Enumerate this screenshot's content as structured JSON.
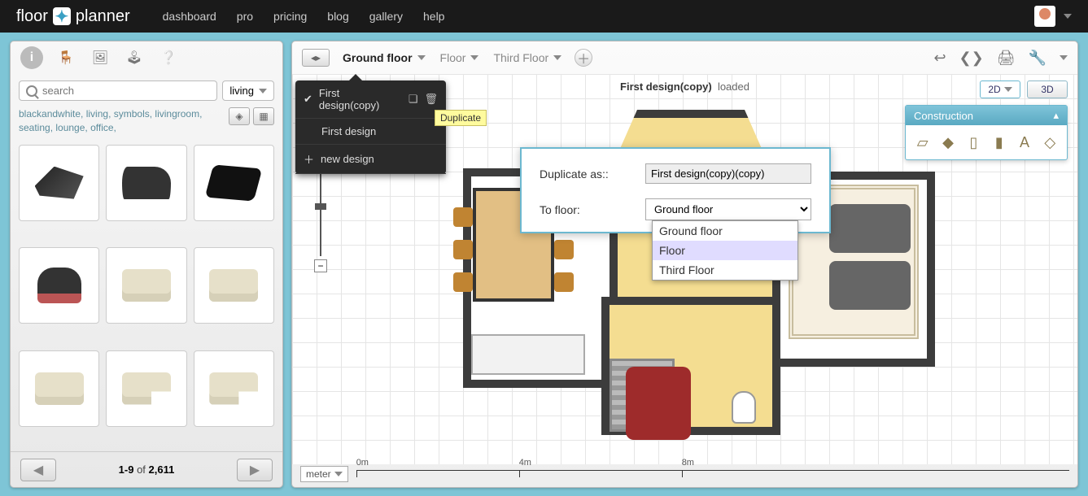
{
  "topnav": {
    "brand1": "floor",
    "brand2": "planner",
    "menu": [
      "dashboard",
      "pro",
      "pricing",
      "blog",
      "gallery",
      "help"
    ]
  },
  "sidebar": {
    "search_placeholder": "search",
    "category": "living",
    "tags": "blackandwhite, living, symbols, livingroom, seating, lounge, office,",
    "page_range": "1-9",
    "page_of": "of",
    "page_total": "2,611"
  },
  "floors": {
    "tabs": [
      {
        "label": "Ground floor",
        "active": true
      },
      {
        "label": "Floor",
        "active": false
      },
      {
        "label": "Third Floor",
        "active": false
      }
    ]
  },
  "design_menu": {
    "items": [
      {
        "label": "First design(copy)",
        "checked": true,
        "has_actions": true
      },
      {
        "label": "First design",
        "checked": false,
        "has_actions": false
      }
    ],
    "new_label": "new design",
    "tooltip": "Duplicate"
  },
  "plan": {
    "name": "First design(copy)",
    "status": "loaded"
  },
  "duplicate_dialog": {
    "label_name": "Duplicate as::",
    "value_name": "First design(copy)(copy)",
    "label_floor": "To floor:",
    "selected_floor": "Ground floor",
    "floor_options": [
      "Ground floor",
      "Floor",
      "Third Floor"
    ],
    "highlighted_option": "Floor"
  },
  "viewmode": {
    "btn2d": "2D",
    "btn3d": "3D"
  },
  "construction": {
    "title": "Construction"
  },
  "scale": {
    "unit": "meter",
    "ticks": [
      "0m",
      "4m",
      "8m"
    ]
  }
}
